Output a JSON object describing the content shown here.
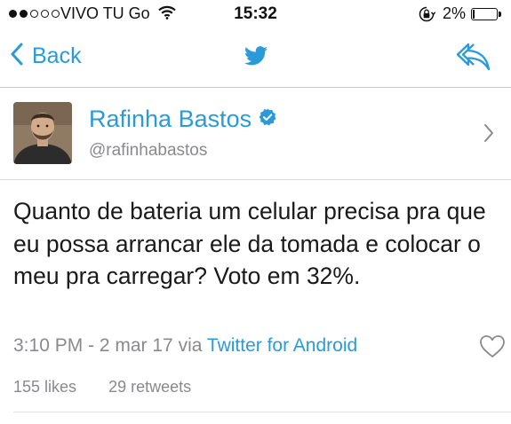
{
  "status_bar": {
    "signal_bars_filled": 2,
    "signal_bars_total": 5,
    "carrier": "VIVO TU Go",
    "time": "15:32",
    "battery_percent": "2%",
    "battery_level": 0.02,
    "icons": [
      "wifi-icon",
      "orientation-lock-icon",
      "battery-icon"
    ]
  },
  "nav": {
    "back_label": "Back",
    "center_icon": "twitter-bird-icon",
    "right_icon": "reply-icon",
    "accent_color": "#2a9ad9"
  },
  "profile": {
    "name": "Rafinha Bastos",
    "verified": true,
    "handle": "@rafinhabastos"
  },
  "tweet": {
    "text": "Quanto de bateria um celular precisa pra que eu possa arrancar ele da tomada e colocar o meu pra carregar? Voto em 32%.",
    "timestamp": "3:10 PM - 2 mar 17",
    "via": "via",
    "source": "Twitter for Android",
    "likes": "155 likes",
    "retweets": "29 retweets"
  }
}
